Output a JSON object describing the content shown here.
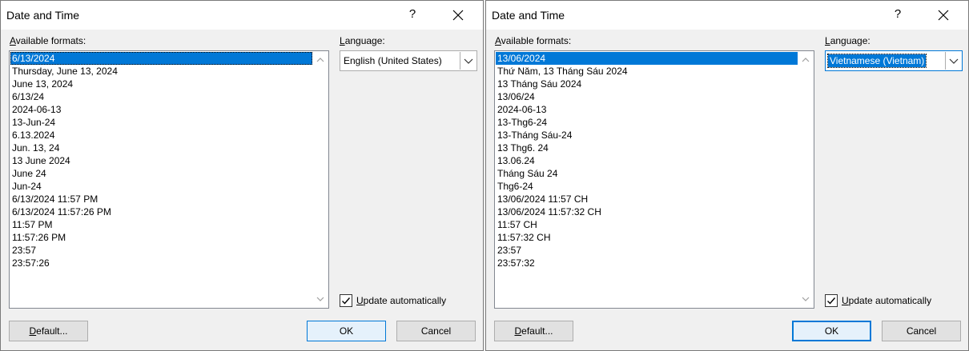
{
  "dialogs": [
    {
      "title": "Date and Time",
      "help_label": "?",
      "formats_label": "Available formats:",
      "language_label": "Language:",
      "language_value": "English (United States)",
      "update_label": "Update automatically",
      "update_checked": true,
      "default_button": "Default...",
      "ok_button": "OK",
      "cancel_button": "Cancel",
      "formats": [
        "6/13/2024",
        "Thursday, June 13, 2024",
        "June 13, 2024",
        "6/13/24",
        "2024-06-13",
        "13-Jun-24",
        "6.13.2024",
        "Jun. 13, 24",
        "13 June 2024",
        "June 24",
        "Jun-24",
        "6/13/2024 11:57 PM",
        "6/13/2024 11:57:26 PM",
        "11:57 PM",
        "11:57:26 PM",
        "23:57",
        "23:57:26"
      ]
    },
    {
      "title": "Date and Time",
      "help_label": "?",
      "formats_label": "Available formats:",
      "language_label": "Language:",
      "language_value": "Vietnamese (Vietnam)",
      "update_label": "Update automatically",
      "update_checked": true,
      "default_button": "Default...",
      "ok_button": "OK",
      "cancel_button": "Cancel",
      "formats": [
        "13/06/2024",
        "Thứ Năm, 13 Tháng Sáu 2024",
        "13 Tháng Sáu 2024",
        "13/06/24",
        "2024-06-13",
        "13-Thg6-24",
        "13-Tháng Sáu-24",
        "13 Thg6. 24",
        "13.06.24",
        "Tháng Sáu 24",
        "Thg6-24",
        "13/06/2024 11:57 CH",
        "13/06/2024 11:57:32 CH",
        "11:57 CH",
        "11:57:32 CH",
        "23:57",
        "23:57:32"
      ]
    }
  ],
  "icons": {
    "close": "close-icon",
    "scroll_up": "chevron-up-icon",
    "scroll_down": "chevron-down-icon",
    "dropdown": "chevron-down-icon",
    "check": "checkmark-icon"
  },
  "colors": {
    "selection": "#0078d7",
    "window_bg": "#f0f0f0"
  }
}
